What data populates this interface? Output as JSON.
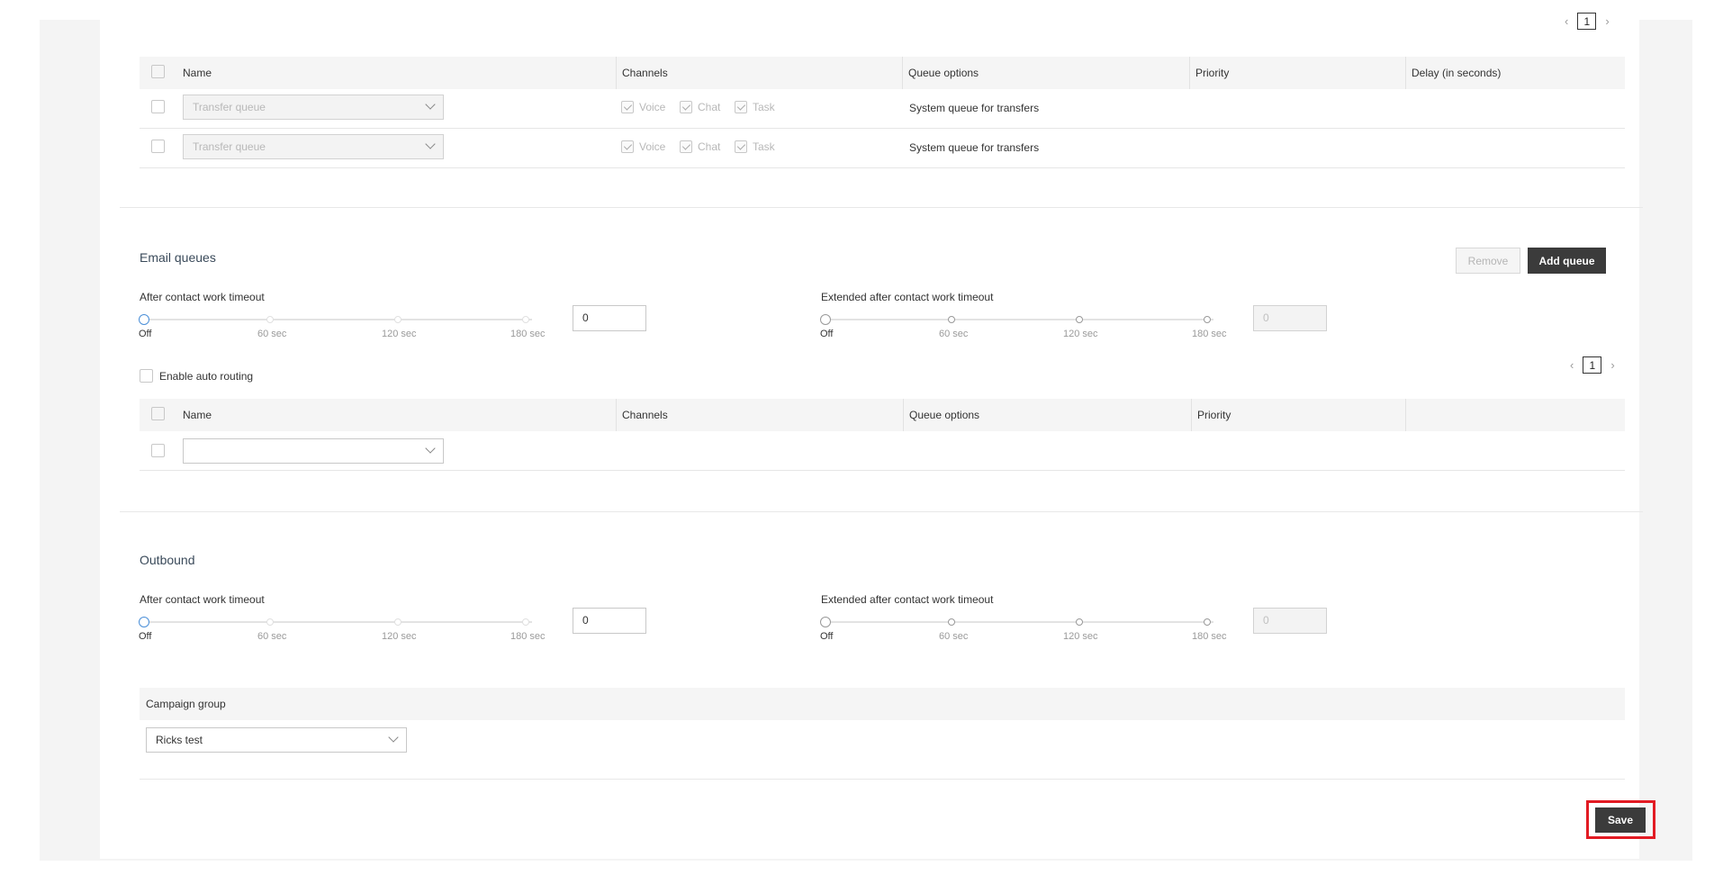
{
  "pager": {
    "prev_icon": "chevron-left-icon",
    "next_icon": "chevron-right-icon",
    "top_page": "1",
    "email_page": "1"
  },
  "transfer_table": {
    "columns": [
      "Name",
      "Channels",
      "Queue options",
      "Priority",
      "Delay (in seconds)"
    ],
    "rows": [
      {
        "name": "Transfer queue",
        "channels": [
          "Voice",
          "Chat",
          "Task"
        ],
        "queue_options": "System queue for transfers"
      },
      {
        "name": "Transfer queue",
        "channels": [
          "Voice",
          "Chat",
          "Task"
        ],
        "queue_options": "System queue for transfers"
      }
    ]
  },
  "email": {
    "title": "Email queues",
    "remove_label": "Remove",
    "add_label": "Add queue",
    "acw_label": "After contact work timeout",
    "acw_value": "0",
    "ext_label": "Extended after contact work timeout",
    "ext_value": "0",
    "ticks": [
      "Off",
      "60 sec",
      "120 sec",
      "180 sec"
    ],
    "auto_routing_label": "Enable auto routing",
    "columns": [
      "Name",
      "Channels",
      "Queue options",
      "Priority"
    ]
  },
  "outbound": {
    "title": "Outbound",
    "acw_label": "After contact work timeout",
    "acw_value": "0",
    "ext_label": "Extended after contact work timeout",
    "ext_value": "0",
    "ticks": [
      "Off",
      "60 sec",
      "120 sec",
      "180 sec"
    ],
    "campaign_label": "Campaign group",
    "campaign_value": "Ricks test"
  },
  "footer": {
    "save_label": "Save"
  },
  "colors": {
    "primary_button": "#3b3b3b",
    "highlight": "#e21b23",
    "slider_active": "#4a8fd8"
  }
}
